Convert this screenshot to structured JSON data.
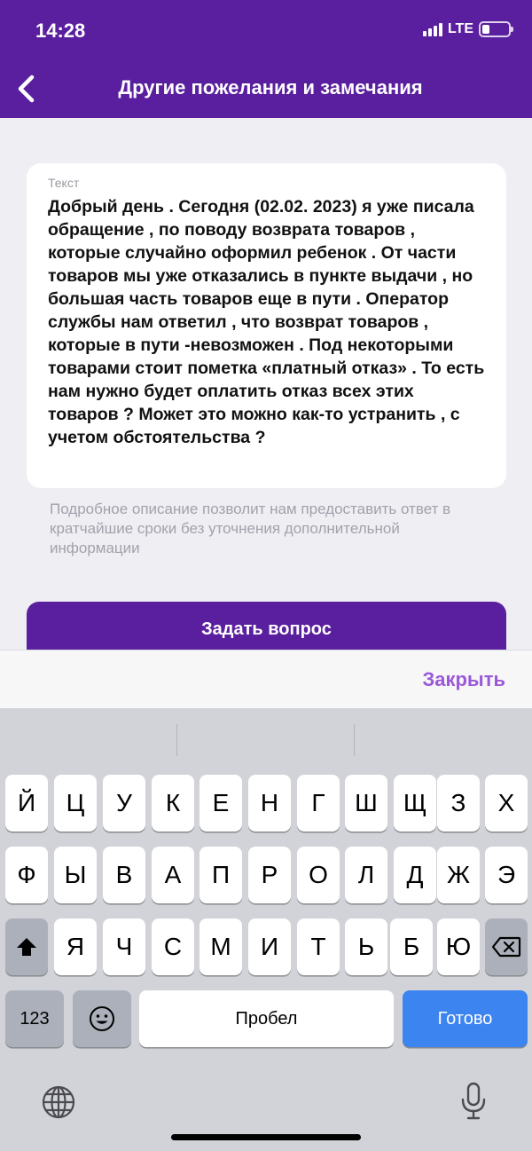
{
  "status": {
    "time": "14:28",
    "network": "LTE"
  },
  "header": {
    "title": "Другие пожелания и замечания"
  },
  "card": {
    "label": "Текст",
    "text": "Добрый день . Сегодня (02.02. 2023) я уже писала обращение , по поводу возврата товаров , которые случайно оформил ребенок . От части товаров мы уже отказались в пункте выдачи , но большая часть товаров еще в пути . Оператор службы нам ответил , что возврат товаров , которые в пути -невозможен . Под некоторыми товарами стоит пометка «платный отказ» . То есть нам нужно будет оплатить отказ всех этих товаров ? Может это можно как-то устранить , с учетом обстоятельства ?"
  },
  "hint": "Подробное описание позволит нам предоставить ответ в кратчайшие сроки без уточнения дополнительной информации",
  "ask_button": "Задать вопрос",
  "accessory": {
    "close": "Закрыть"
  },
  "keyboard": {
    "row1": [
      "Й",
      "Ц",
      "У",
      "К",
      "Е",
      "Н",
      "Г",
      "Ш",
      "Щ",
      "З",
      "Х"
    ],
    "row2": [
      "Ф",
      "Ы",
      "В",
      "А",
      "П",
      "Р",
      "О",
      "Л",
      "Д",
      "Ж",
      "Э"
    ],
    "row3": [
      "Я",
      "Ч",
      "С",
      "М",
      "И",
      "Т",
      "Ь",
      "Б",
      "Ю"
    ],
    "numbers": "123",
    "space": "Пробел",
    "done": "Готово"
  },
  "icons": {
    "back": "chevron-left-icon",
    "shift": "shift-icon",
    "delete": "backspace-icon",
    "emoji": "emoji-icon",
    "globe": "globe-icon",
    "mic": "microphone-icon"
  },
  "colors": {
    "brand": "#5a1f9e",
    "accent": "#9b59d8",
    "done": "#3c84f0"
  }
}
